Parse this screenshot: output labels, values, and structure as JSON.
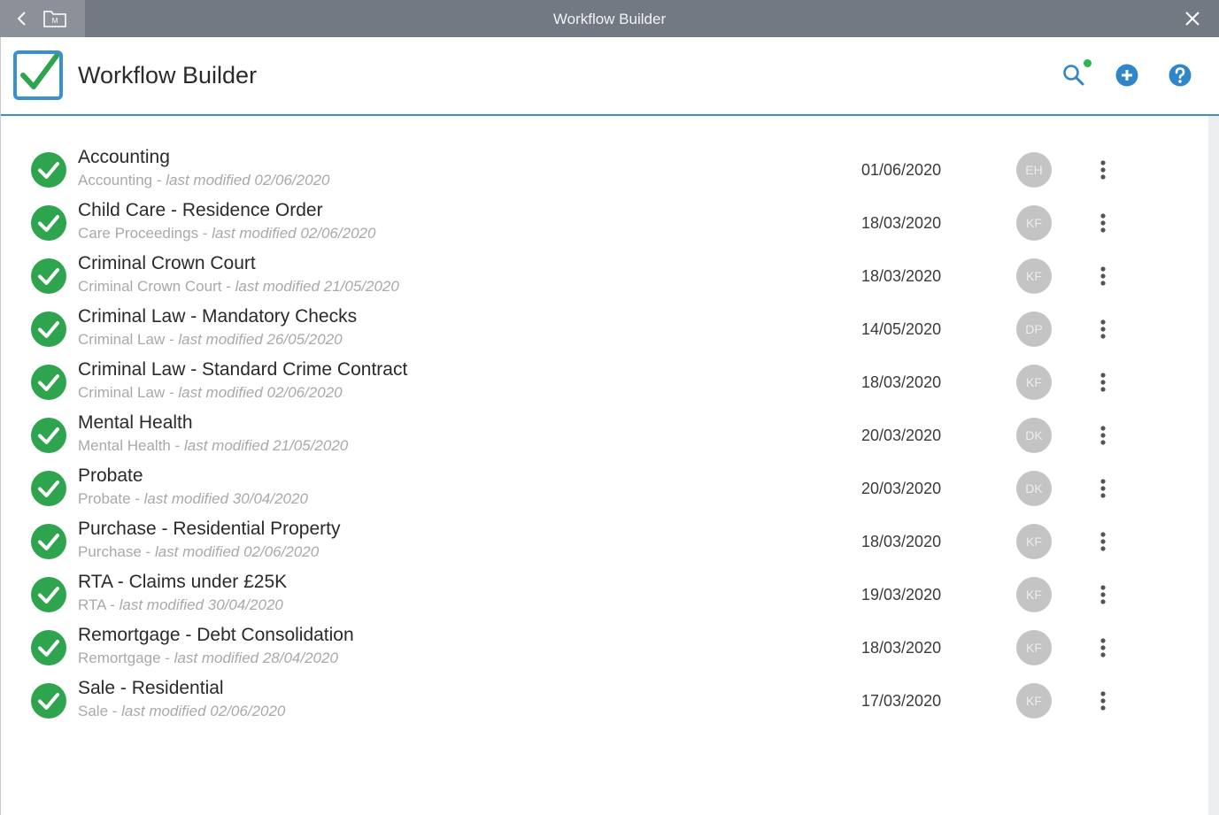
{
  "window": {
    "title": "Workflow Builder",
    "folder_label": "M"
  },
  "header": {
    "title": "Workflow Builder",
    "accent_color": "#3a8fd0",
    "notification_color": "#2fb54b"
  },
  "icons": {
    "back": "chevron-left-icon",
    "folder": "folder-icon",
    "close": "close-icon",
    "logo": "checkbox-logo-icon",
    "search": "search-icon",
    "add": "plus-circle-icon",
    "help": "question-circle-icon",
    "status": "check-circle-icon",
    "more": "more-vertical-icon"
  },
  "colors": {
    "status_green": "#2ea44f",
    "avatar_grey": "#c4c4c4"
  },
  "workflows": [
    {
      "name": "Accounting",
      "category": "Accounting",
      "modified": "last modified 02/06/2020",
      "date": "01/06/2020",
      "initials": "EH"
    },
    {
      "name": "Child Care - Residence Order",
      "category": "Care Proceedings",
      "modified": "last modified 02/06/2020",
      "date": "18/03/2020",
      "initials": "KF"
    },
    {
      "name": "Criminal Crown Court",
      "category": "Criminal Crown Court",
      "modified": "last modified 21/05/2020",
      "date": "18/03/2020",
      "initials": "KF"
    },
    {
      "name": "Criminal Law - Mandatory Checks",
      "category": "Criminal Law",
      "modified": "last modified 26/05/2020",
      "date": "14/05/2020",
      "initials": "DP"
    },
    {
      "name": "Criminal Law - Standard Crime Contract",
      "category": "Criminal Law",
      "modified": "last modified 02/06/2020",
      "date": "18/03/2020",
      "initials": "KF"
    },
    {
      "name": "Mental Health",
      "category": "Mental Health",
      "modified": "last modified 21/05/2020",
      "date": "20/03/2020",
      "initials": "DK"
    },
    {
      "name": "Probate",
      "category": "Probate",
      "modified": "last modified 30/04/2020",
      "date": "20/03/2020",
      "initials": "DK"
    },
    {
      "name": "Purchase - Residential Property",
      "category": "Purchase",
      "modified": "last modified 02/06/2020",
      "date": "18/03/2020",
      "initials": "KF"
    },
    {
      "name": "RTA - Claims under £25K",
      "category": "RTA",
      "modified": "last modified 30/04/2020",
      "date": "19/03/2020",
      "initials": "KF"
    },
    {
      "name": "Remortgage - Debt Consolidation",
      "category": "Remortgage",
      "modified": "last modified 28/04/2020",
      "date": "18/03/2020",
      "initials": "KF"
    },
    {
      "name": "Sale - Residential",
      "category": "Sale",
      "modified": "last modified 02/06/2020",
      "date": "17/03/2020",
      "initials": "KF"
    }
  ]
}
